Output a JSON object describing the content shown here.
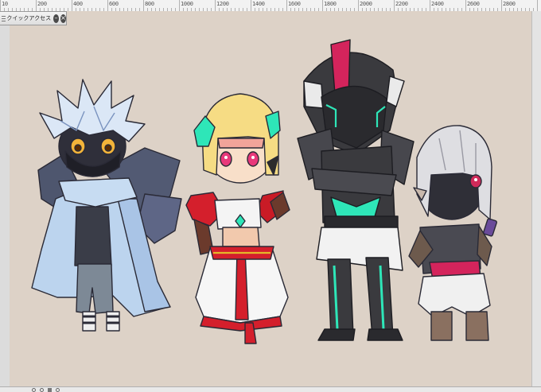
{
  "ruler": {
    "labels": [
      "10",
      "200",
      "400",
      "600",
      "800",
      "1000",
      "1200",
      "1400",
      "1600",
      "1800",
      "2000",
      "2200",
      "2400",
      "2600",
      "2800"
    ]
  },
  "quick_access": {
    "title": "クイックアクセス",
    "grip_icon": "grip-icon",
    "minimize_icon": "minimize-icon",
    "close_icon": "close-icon"
  },
  "canvas": {
    "background": "#ddd2c7"
  },
  "colors": {
    "accent_teal": "#2ee6b8",
    "accent_red": "#d41f2c",
    "armor_dark": "#3a3a3e",
    "coat_blue": "#b9d3ee",
    "hair_blonde": "#f6dc84"
  }
}
